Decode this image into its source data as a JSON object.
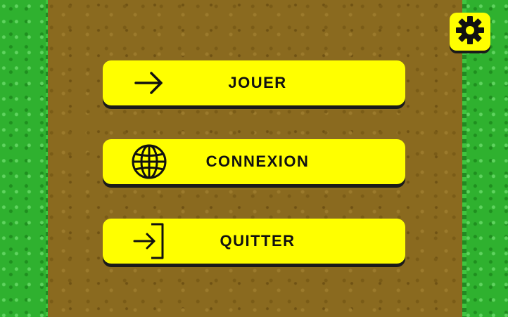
{
  "menu": {
    "play_label": "JOUER",
    "play_icon": "arrow-right-icon",
    "login_label": "CONNEXION",
    "login_icon": "globe-icon",
    "quit_label": "QUITTER",
    "quit_icon": "exit-door-icon"
  },
  "settings": {
    "icon": "gear-icon"
  },
  "colors": {
    "button": "#ffff00",
    "grass": "#2fb12f",
    "dirt": "#8a6a1f",
    "text": "#111111"
  }
}
